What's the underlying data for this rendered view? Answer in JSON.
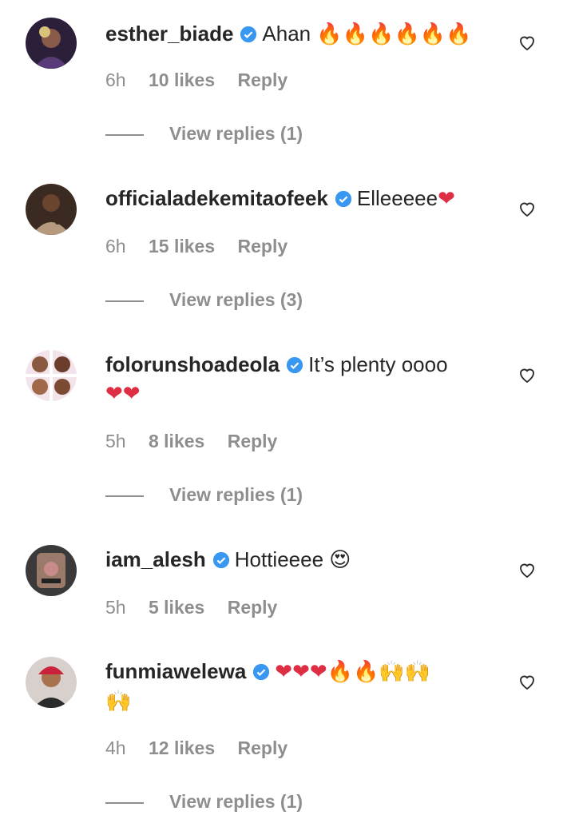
{
  "colors": {
    "verified": "#3897f0",
    "meta": "#8e8e8e",
    "text": "#262626",
    "fire": "#f4900c",
    "red_heart": "#dd2e44"
  },
  "comments": [
    {
      "username": "esther_biade",
      "text": "Ahan",
      "emoji": "🔥🔥🔥🔥🔥🔥",
      "time": "6h",
      "likes": "10 likes",
      "reply": "Reply",
      "view_replies": "View replies (1)"
    },
    {
      "username": "officialadekemitaofeek",
      "text": "Elleeeee",
      "emoji": "❤",
      "time": "6h",
      "likes": "15 likes",
      "reply": "Reply",
      "view_replies": "View replies (3)"
    },
    {
      "username": "folorunshoadeola",
      "text": "It’s plenty oooo",
      "emoji": "❤❤",
      "time": "5h",
      "likes": "8 likes",
      "reply": "Reply",
      "view_replies": "View replies (1)"
    },
    {
      "username": "iam_alesh",
      "text": "Hottieeee",
      "emoji": "😍",
      "time": "5h",
      "likes": "5 likes",
      "reply": "Reply",
      "view_replies": ""
    },
    {
      "username": "funmiawelewa",
      "text": "",
      "emoji": "❤❤❤🔥🔥🙌🙌",
      "emoji2": "🙌",
      "time": "4h",
      "likes": "12 likes",
      "reply": "Reply",
      "view_replies": "View replies (1)"
    }
  ],
  "icons": {
    "verified": "verified-badge-icon",
    "like": "heart-outline-icon"
  }
}
